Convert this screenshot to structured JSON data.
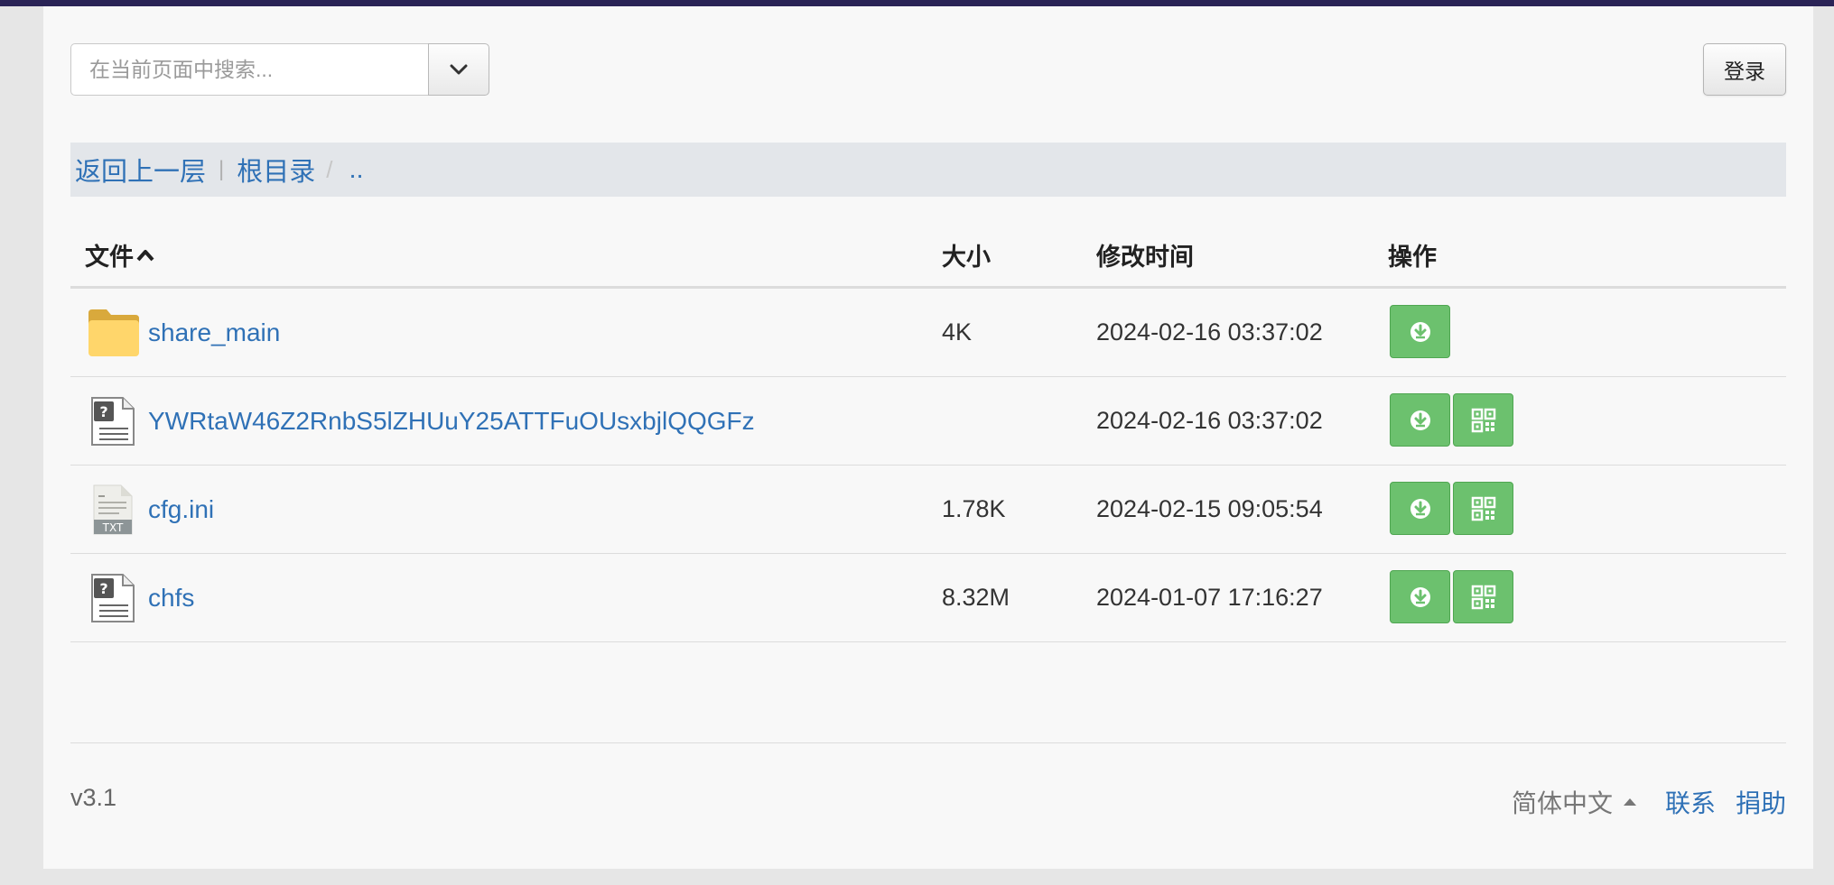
{
  "search": {
    "placeholder": "在当前页面中搜索...",
    "value": ""
  },
  "header": {
    "login_label": "登录"
  },
  "breadcrumb": {
    "back_label": "返回上一层",
    "separator": "|",
    "root_label": "根目录",
    "slash": "/",
    "current": ".."
  },
  "table": {
    "columns": {
      "name": "文件",
      "size": "大小",
      "mtime": "修改时间",
      "actions": "操作"
    },
    "rows": [
      {
        "name": "share_main",
        "size": "4K",
        "mtime": "2024-02-16 03:37:02",
        "type": "folder-icon",
        "qr": false
      },
      {
        "name": "YWRtaW46Z2RnbS5lZHUuY25ATTFuOUsxbjlQQGFz",
        "size": "",
        "mtime": "2024-02-16 03:37:02",
        "type": "unknown-file-icon",
        "qr": true
      },
      {
        "name": "cfg.ini",
        "size": "1.78K",
        "mtime": "2024-02-15 09:05:54",
        "type": "txt-file-icon",
        "txt_label": "TXT",
        "qr": true
      },
      {
        "name": "chfs",
        "size": "8.32M",
        "mtime": "2024-01-07 17:16:27",
        "type": "unknown-file-icon",
        "qr": true
      }
    ]
  },
  "footer": {
    "version": "v3.1",
    "language": "简体中文",
    "contact": "联系",
    "donate": "捐助"
  },
  "colors": {
    "topbar": "#2a2356",
    "link": "#2f71b6",
    "button_green": "#6cc16e",
    "folder": "#ffd66b"
  }
}
